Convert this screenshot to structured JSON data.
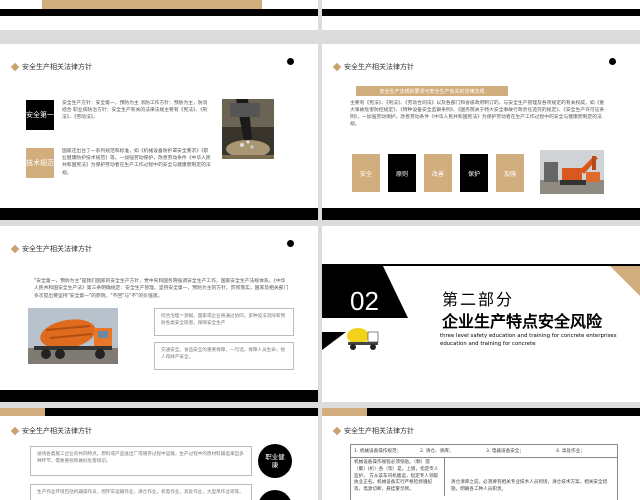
{
  "section_title": "安全生产相关法律方针",
  "slide2": {
    "tag_top": "安全第一",
    "tag_bottom": "技术规范",
    "para_top": "安全生产方针：安全第一，预防为主 消防工作方针：预防为主，防消结合 职业病防治方针：安全生产有关的法律法规主要有《宪法》、《刑法》、《劳动法》。",
    "para_bottom": "国家还出台了一系列规范和标准，如《机械设备防护罩安全要求》《职业健康防护技术规范》等。一加强劳动保护，改善劳动条件《中华人民共和国宪法》为保护劳动者在生产工作过程中的安全与健康而制定的法规。"
  },
  "slide3": {
    "banner": "安全生产法规的要求与安全生产有关的法律法规",
    "para": "主要有《宪法》、《刑法》、《劳动合同法》以及各部门和省级政府制订的。与安全生产管理及各项规定的有关权威，如《重大事故危害防控规定》、《特种设备安全监察条例》、《国务院关于特大安全事故行政责任追究的规定》、《安全生产许可证条例》，一加强劳动保护。改善劳动条件《中华人民共和国宪法》为保护劳动者在生产工作过程中的安全与健康而制定的法规。",
    "boxes": [
      "安全",
      "原则",
      "改善",
      "保护",
      "加强"
    ]
  },
  "slide4": {
    "quote": "\"安全第一，预防为主\"是我们国家的安全生产方针，党中央和国务院强调安全生产工作，国家安全生产法规体系。《中华人民共和国安全生产法》第三条明确规定：安全生产管理，坚持安全第一，预防为主的方针。贯彻落实，国家及相关部门多次提出要坚持\"安全第一\"的原则，\"不回\"与\"不\"的价值观。",
    "card_top": "综合治理＝源报。国家或企业将通过协同，多种设法消除和预防各类安全隐患，保障安全生产",
    "card_bottom": "交通安全。食品安全的重要保障，一句话。保障人员生命，他人和财产安全。"
  },
  "slide5": {
    "number": "02",
    "heading_small": "第二部分",
    "heading_big": "企业生产特点安全风险",
    "en_text": "three level safety education and training for concrete enterprises education and training for concrete"
  },
  "slide6": {
    "card1": "进场各类施工企业的共同特点。原料或产品送出厂或储存过程中运输，生产过程中的原材料输运来自多种环节，需要重视和做好危害辨识。",
    "card2": "生产作业环境包括机器操作员，围环车运输作业，清仓作业，机电作业，高处作业，大型吊作业等等。",
    "circle": "职业健康"
  },
  "slide7": {
    "row1": [
      "1. 机械设备操作规范；",
      "2. 清仓、清库；",
      "3. 电器设备安全；",
      "4. 高处作业；"
    ],
    "cell_left": "机械设备操作规程必须张贴。（颗）搅（聚）(桁）各（架）是。上镀，指定专人监护。 方从该车司机搬运，指定专人领取执业正名。机械设备实行严格检修遵纪等，电源切断，悬挂警示牌。",
    "cell_right": "清仓清库之前，必须要有相关专业技术人员到场，清仓技术方案，相关安全措施，明确各工种人员职责。"
  }
}
